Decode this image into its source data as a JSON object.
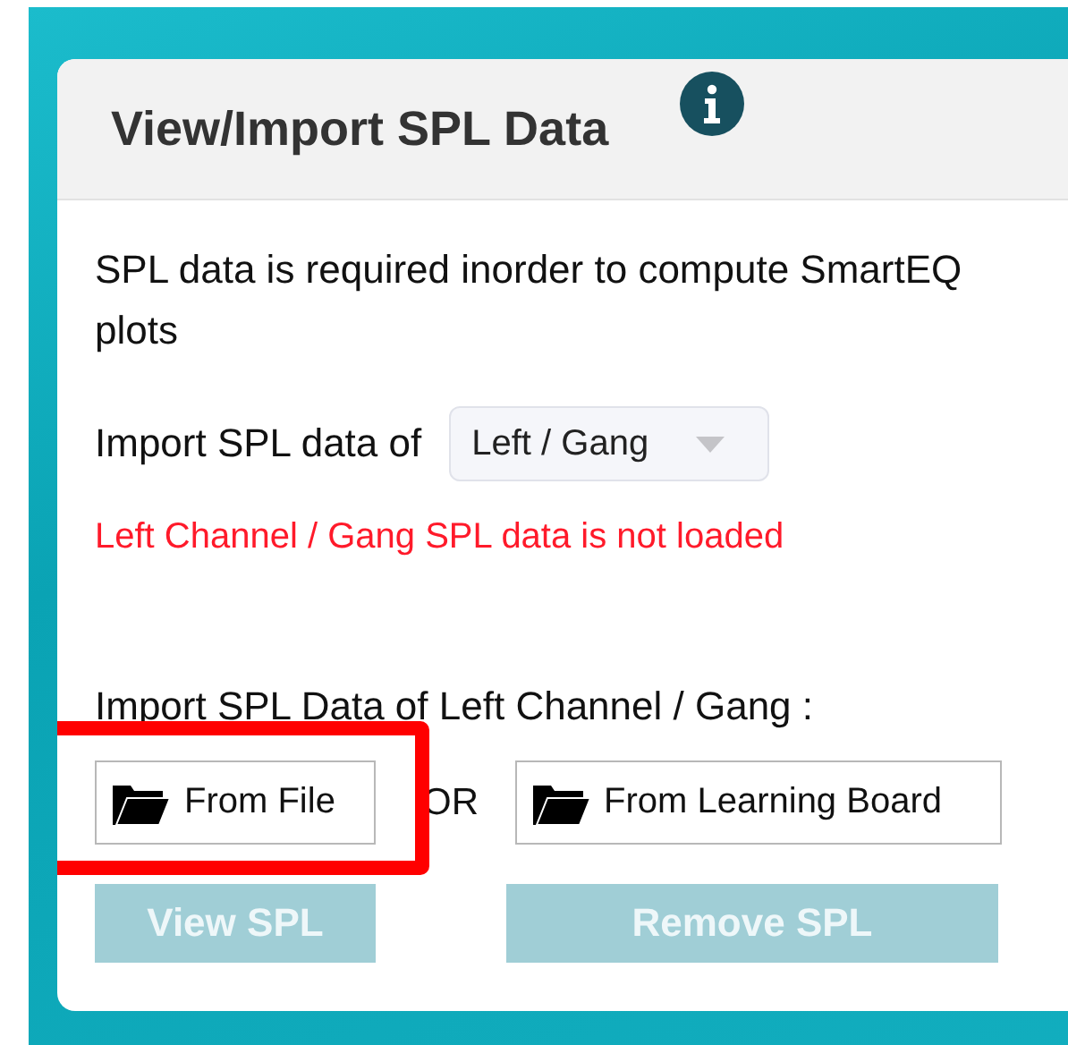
{
  "panel": {
    "title": "View/Import SPL Data"
  },
  "description": "SPL data is required inorder to compute SmartEQ plots",
  "channel_select": {
    "label": "Import SPL data of",
    "value": "Left / Gang"
  },
  "error": "Left Channel / Gang SPL data is not loaded",
  "import_label": "Import SPL Data of Left Channel / Gang :",
  "import_buttons": [
    {
      "label": "From File",
      "highlighted": true
    },
    {
      "label": "From Learning Board",
      "highlighted": false
    }
  ],
  "separator": "OR",
  "action_buttons": [
    {
      "label": "View SPL",
      "disabled": true
    },
    {
      "label": "Remove SPL",
      "disabled": true
    }
  ]
}
